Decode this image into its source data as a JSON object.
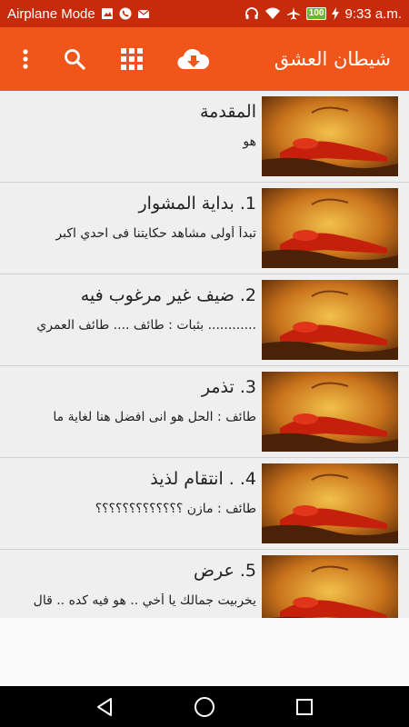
{
  "status_bar": {
    "carrier": "Airplane Mode",
    "battery": "100",
    "time": "9:33 a.m."
  },
  "toolbar": {
    "title": "شيطان العشق",
    "icons": [
      "more-vert-icon",
      "search-icon",
      "grid-icon",
      "cloud-download-icon"
    ]
  },
  "colors": {
    "status_bar": "#c62c0b",
    "toolbar": "#f0561a",
    "list_bg": "#efefef"
  },
  "list": {
    "items": [
      {
        "title": "المقدمة",
        "subtitle": "هو"
      },
      {
        "title": "1. بداية المشوار",
        "subtitle": "تبدأ أولى مشاهد حكايتنا فى احدي اكبر"
      },
      {
        "title": "2. ضيف غير مرغوب فيه",
        "subtitle": "............ بثبات : طائف .... طائف العمري"
      },
      {
        "title": "3. تذمر",
        "subtitle": "طائف : الحل هو انى افضل هنا لغاية ما"
      },
      {
        "title": "4. . انتقام لذيذ",
        "subtitle": "طائف : مازن ؟؟؟؟؟؟؟؟؟؟؟؟؟"
      },
      {
        "title": "5. عرض",
        "subtitle": "يخربيت جمالك يا أخي .. هو فيه كده .. قال"
      }
    ]
  }
}
